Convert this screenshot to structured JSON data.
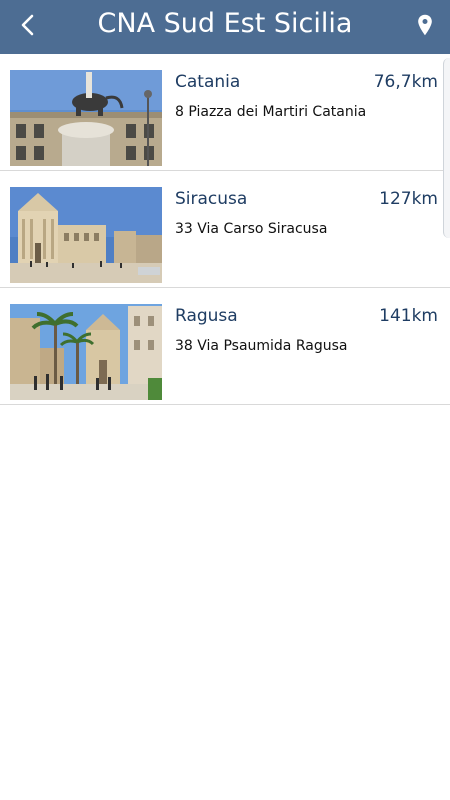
{
  "header": {
    "title": "CNA Sud Est Sicilia",
    "back_icon": "chevron-left-icon",
    "map_icon": "map-pin-icon",
    "background": "#4d6d93"
  },
  "locations": [
    {
      "city": "Catania",
      "distance": "76,7km",
      "address": "8 Piazza dei Martiri Catania",
      "image": "catania-elephant-fountain-photo"
    },
    {
      "city": "Siracusa",
      "distance": "127km",
      "address": "33 Via Carso Siracusa",
      "image": "siracusa-cathedral-square-photo"
    },
    {
      "city": "Ragusa",
      "distance": "141km",
      "address": "38 Via Psaumida Ragusa",
      "image": "ragusa-palm-street-photo"
    }
  ],
  "colors": {
    "text_primary": "#1f3d63",
    "text_secondary": "#111111",
    "divider": "#d9d9d9"
  }
}
